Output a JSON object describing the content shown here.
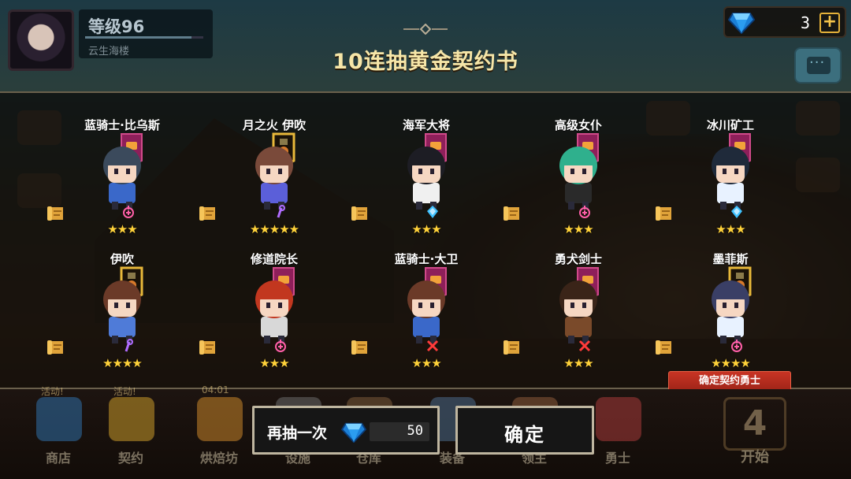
{
  "player": {
    "level": "等级96",
    "name": "云生海楼",
    "level_progress": 0.9
  },
  "currency": {
    "gem_count": "3",
    "add_label": "+"
  },
  "title": "10连抽黄金契约书",
  "heroes": [
    {
      "name": "蓝骑士·比乌斯",
      "stars": "★★★",
      "type_icon": "heal-icon",
      "banner": "purple"
    },
    {
      "name": "月之火 伊吹",
      "stars": "★★★★★",
      "type_icon": "magic-icon",
      "banner": "gold"
    },
    {
      "name": "海军大将",
      "stars": "★★★",
      "type_icon": "ice-icon",
      "banner": "purple"
    },
    {
      "name": "高级女仆",
      "stars": "★★★",
      "type_icon": "heal-icon",
      "banner": "purple"
    },
    {
      "name": "冰川矿工",
      "stars": "★★★",
      "type_icon": "ice-icon",
      "banner": "purple"
    },
    {
      "name": "伊吹",
      "stars": "★★★★",
      "type_icon": "magic-icon",
      "banner": "gold"
    },
    {
      "name": "修道院长",
      "stars": "★★★",
      "type_icon": "heal-icon",
      "banner": "purple"
    },
    {
      "name": "蓝骑士·大卫",
      "stars": "★★★",
      "type_icon": "sword-icon",
      "banner": "purple"
    },
    {
      "name": "勇犬剑士",
      "stars": "★★★",
      "type_icon": "sword-icon",
      "banner": "purple"
    },
    {
      "name": "墨菲斯",
      "stars": "★★★★",
      "type_icon": "heal-icon",
      "banner": "gold"
    }
  ],
  "confirm_hero_label": "确定契约勇士",
  "actions": {
    "draw_again_label": "再抽一次",
    "draw_again_cost": "50",
    "confirm_label": "确定"
  },
  "nav": {
    "items": [
      {
        "label": "商店",
        "tag": "活动!"
      },
      {
        "label": "契约",
        "tag": "活动!"
      },
      {
        "label": "烘焙坊",
        "tag": "04:01"
      },
      {
        "label": "设施",
        "tag": ""
      },
      {
        "label": "仓库",
        "tag": ""
      },
      {
        "label": "装备",
        "tag": ""
      },
      {
        "label": "领主",
        "tag": ""
      },
      {
        "label": "勇士",
        "tag": ""
      }
    ],
    "start_label": "开始",
    "start_badge": "4"
  },
  "colors": {
    "title": "#f6e6a8",
    "star": "#ffd23a",
    "confirm_tag_bg": "#c83424",
    "panel_border": "#6a604c"
  }
}
